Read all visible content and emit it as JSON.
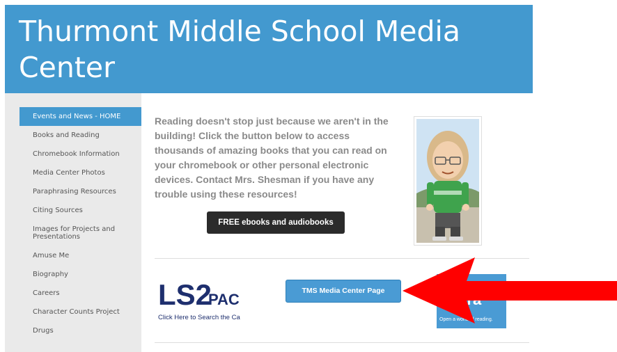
{
  "header": {
    "title": "Thurmont Middle School Media Center"
  },
  "sidebar": {
    "items": [
      {
        "label": "Events and News - HOME",
        "active": true
      },
      {
        "label": "Books and Reading"
      },
      {
        "label": "Chromebook Information"
      },
      {
        "label": "Media Center Photos"
      },
      {
        "label": "Paraphrasing Resources"
      },
      {
        "label": "Citing Sources"
      },
      {
        "label": "Images for Projects and Presentations"
      },
      {
        "label": "Amuse Me"
      },
      {
        "label": "Biography"
      },
      {
        "label": "Careers"
      },
      {
        "label": "Character Counts Project"
      },
      {
        "label": "Drugs"
      }
    ]
  },
  "main": {
    "intro_text": "Reading doesn't stop just because we aren't in the building!  Click the button below to access thousands of amazing books that you can read on your chromebook or other personal electronic devices.  Contact Mrs. Shesman if you have any trouble using these resources!",
    "ebooks_button": "FREE ebooks and audiobooks",
    "media_center_button": "TMS Media Center Page",
    "ls2pac": {
      "logo_top": "LS2",
      "logo_suffix": "PAC",
      "caption": "Click Here to Search the Catalog"
    },
    "sora": {
      "name": "ora",
      "tagline": "Open a world of reading."
    }
  },
  "colors": {
    "header_bg": "#4399cf",
    "sidebar_bg": "#eaeaea",
    "arrow": "#ff0000",
    "dark_button": "#2b2b2b",
    "blue_button": "#4a9bd4"
  },
  "icons": {
    "bitmoji": "bitmoji-avatar",
    "arrow": "red-arrow-pointer"
  }
}
